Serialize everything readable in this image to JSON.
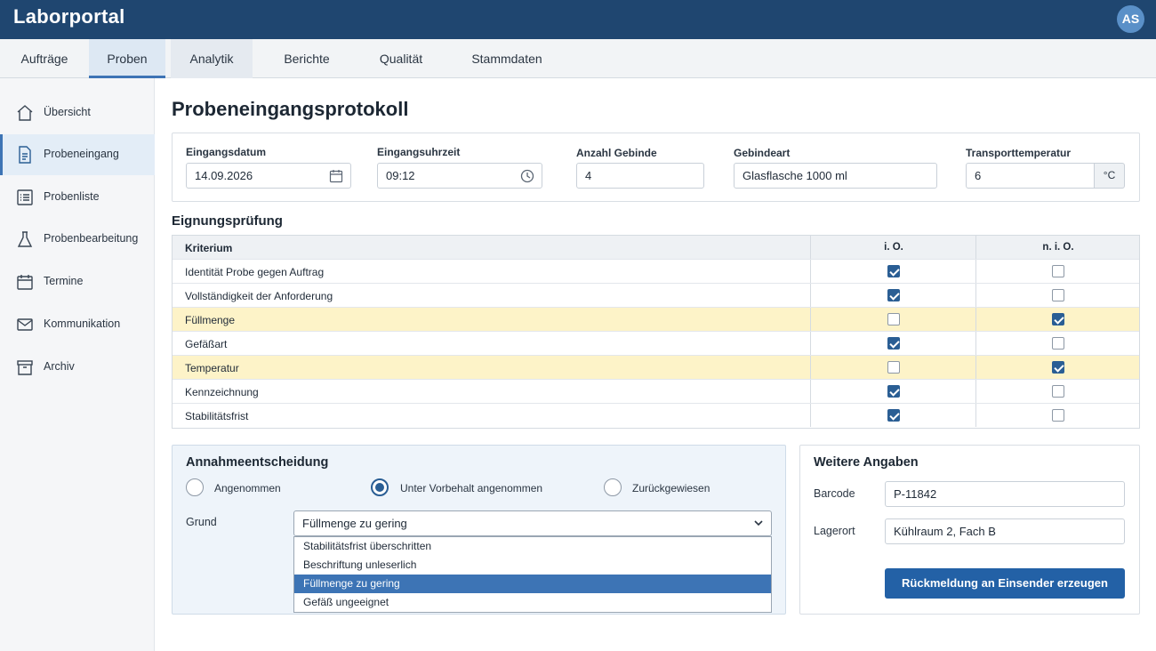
{
  "app": {
    "title": "Laborportal",
    "user_initials": "AS"
  },
  "tabs": [
    {
      "label": "Aufträge"
    },
    {
      "label": "Proben"
    },
    {
      "label": "Analytik"
    },
    {
      "label": "Berichte"
    },
    {
      "label": "Qualität"
    },
    {
      "label": "Stammdaten"
    }
  ],
  "sidebar": {
    "items": [
      {
        "label": "Übersicht",
        "icon": "home-icon"
      },
      {
        "label": "Probeneingang",
        "icon": "document-icon"
      },
      {
        "label": "Probenliste",
        "icon": "list-icon"
      },
      {
        "label": "Probenbearbeitung",
        "icon": "flask-icon"
      },
      {
        "label": "Termine",
        "icon": "calendar-icon"
      },
      {
        "label": "Kommunikation",
        "icon": "mail-icon"
      },
      {
        "label": "Archiv",
        "icon": "archive-icon"
      }
    ]
  },
  "page": {
    "title": "Probeneingangsprotokoll"
  },
  "receipt": {
    "date_label": "Eingangsdatum",
    "date_value": "14.09.2026",
    "time_label": "Eingangsuhrzeit",
    "time_value": "09:12",
    "count_label": "Anzahl Gebinde",
    "count_value": "4",
    "type_label": "Gebindeart",
    "type_value": "Glasflasche 1000 ml",
    "temp_label": "Transporttemperatur",
    "temp_value": "6",
    "temp_unit": "°C"
  },
  "suitability": {
    "title": "Eignungsprüfung",
    "headers": {
      "criterion": "Kriterium",
      "ok": "i. O.",
      "not_ok": "n. i. O."
    },
    "rows": [
      {
        "criterion": "Identität Probe gegen Auftrag",
        "ok": true,
        "not_ok": false
      },
      {
        "criterion": "Vollständigkeit der Anforderung",
        "ok": true,
        "not_ok": false
      },
      {
        "criterion": "Füllmenge",
        "ok": false,
        "not_ok": true
      },
      {
        "criterion": "Gefäßart",
        "ok": true,
        "not_ok": false
      },
      {
        "criterion": "Temperatur",
        "ok": false,
        "not_ok": true
      },
      {
        "criterion": "Kennzeichnung",
        "ok": true,
        "not_ok": false
      },
      {
        "criterion": "Stabilitätsfrist",
        "ok": true,
        "not_ok": false
      }
    ]
  },
  "decision": {
    "title": "Annahmeentscheidung",
    "options": [
      {
        "label": "Angenommen",
        "selected": false
      },
      {
        "label": "Unter Vorbehalt angenommen",
        "selected": true
      },
      {
        "label": "Zurückgewiesen",
        "selected": false
      }
    ],
    "reason_label": "Grund",
    "reason_value": "Füllmenge zu gering",
    "reason_options": [
      "Stabilitätsfrist überschritten",
      "Beschriftung unleserlich",
      "Füllmenge zu gering",
      "Gefäß ungeeignet"
    ],
    "reason_selected_index": 2
  },
  "more": {
    "title": "Weitere Angaben",
    "barcode_label": "Barcode",
    "barcode_value": "P-11842",
    "location_label": "Lagerort",
    "location_value": "Kühlraum 2, Fach B",
    "action_label": "Rückmeldung an Einsender erzeugen"
  },
  "colors": {
    "header": "#1f4670",
    "accent": "#2361a6",
    "warn_row": "#fdf3c8"
  }
}
